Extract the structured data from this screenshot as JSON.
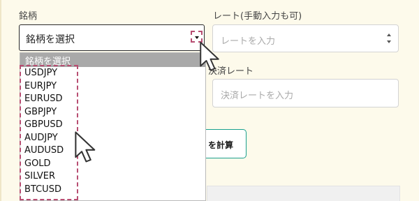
{
  "form": {
    "symbol_label": "銘柄",
    "symbol_select_value": "銘柄を選択",
    "rate_label": "レート(手動入力も可)",
    "rate_placeholder": "レートを入力",
    "settle_label_partial": "決済レート",
    "settle_placeholder": "決済レートを入力",
    "calc_button_label": "を計算"
  },
  "dropdown": {
    "header": "銘柄を選択",
    "options": [
      "USDJPY",
      "EURJPY",
      "EURUSD",
      "GBPJPY",
      "GBPUSD",
      "AUDJPY",
      "AUDUSD",
      "GOLD",
      "SILVER",
      "BTCUSD"
    ]
  },
  "colors": {
    "page_background": "#fdfaeb",
    "highlight": "#b84e72",
    "button_border": "#1aa08e"
  },
  "icons": [
    "chevron-down-icon",
    "spinner-up-icon",
    "spinner-down-icon",
    "mouse-cursor-icon"
  ]
}
